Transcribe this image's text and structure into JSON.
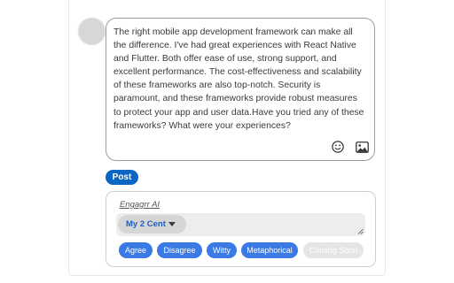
{
  "composer": {
    "text": "The right mobile app development framework can make all the difference. I've had great experiences with React Native and Flutter. Both offer ease of use, strong support, and excellent performance. The cost-effectiveness and scalability of these frameworks are also top-notch. Security is paramount, and these frameworks provide robust measures to protect your app and user data.Have you tried any of these frameworks? What were your experiences?"
  },
  "post_button": {
    "label": "Post"
  },
  "ai_panel": {
    "title": "Engagrr AI",
    "tone": "My 2 Cent",
    "chips": [
      {
        "label": "Agree",
        "enabled": true
      },
      {
        "label": "Disagree",
        "enabled": true
      },
      {
        "label": "Witty",
        "enabled": true
      },
      {
        "label": "Metaphorical",
        "enabled": true
      },
      {
        "label": "Coming Soon",
        "enabled": false
      }
    ]
  },
  "icons": {
    "emoji": "smiley-icon",
    "image": "image-icon",
    "resize": "resize-handle-icon"
  },
  "colors": {
    "accent": "#0a66c2",
    "chip": "#3b7ae4",
    "chip_disabled": "#e5e5e5",
    "tone_text": "#1a5fc8"
  }
}
